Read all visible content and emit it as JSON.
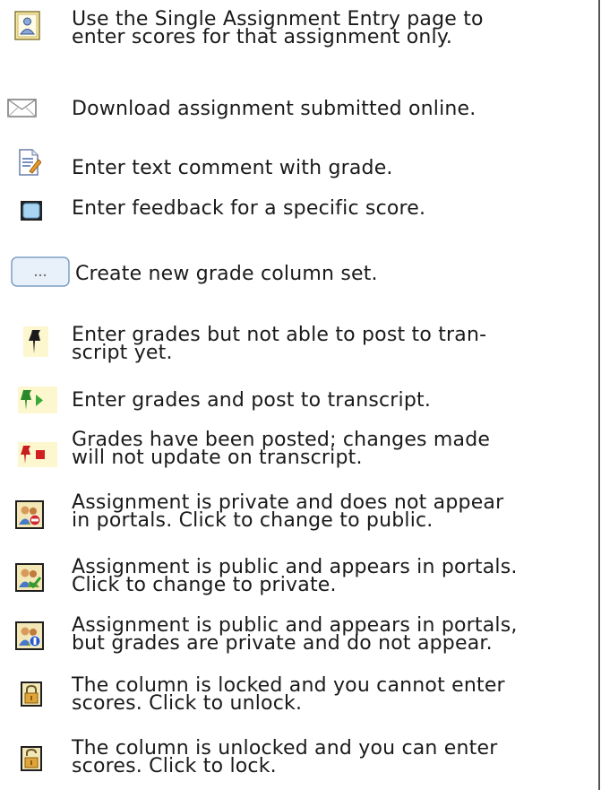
{
  "legend": [
    {
      "id": "single-entry",
      "icon": "single-entry-page-icon",
      "lines": [
        "Use the Single Assignment Entry page to",
        "enter scores for that assignment only."
      ]
    },
    {
      "id": "download",
      "icon": "envelope-icon",
      "lines": [
        "Download assignment submitted online."
      ]
    },
    {
      "id": "text-comment",
      "icon": "comment-document-icon",
      "lines": [
        "Enter text comment with grade."
      ]
    },
    {
      "id": "feedback",
      "icon": "feedback-box-icon",
      "lines": [
        "Enter feedback for a specific score."
      ]
    },
    {
      "id": "column-set",
      "icon": "ellipsis-button-icon",
      "lines": [
        "Create new grade column set."
      ]
    },
    {
      "id": "pin-not-post",
      "icon": "pushpin-icon",
      "lines": [
        "Enter grades but not able to post to tran-",
        "script yet."
      ]
    },
    {
      "id": "pin-post",
      "icon": "pushpin-arrow-icon",
      "lines": [
        "Enter grades and post to transcript."
      ]
    },
    {
      "id": "pin-posted",
      "icon": "pushpin-stop-icon",
      "lines": [
        "Grades have been posted; changes made",
        "will not update on transcript."
      ]
    },
    {
      "id": "private",
      "icon": "private-assignment-icon",
      "lines": [
        "Assignment is private and does not appear",
        "in portals. Click to change to public."
      ]
    },
    {
      "id": "public",
      "icon": "public-assignment-icon",
      "lines": [
        "Assignment is public and appears in portals.",
        "Click to change to private."
      ]
    },
    {
      "id": "public-private-grades",
      "icon": "public-private-grades-icon",
      "lines": [
        "Assignment is public and appears in portals,",
        "but grades are private and do not appear."
      ]
    },
    {
      "id": "locked",
      "icon": "lock-closed-icon",
      "lines": [
        "The column is locked and you cannot enter",
        "scores. Click to unlock."
      ]
    },
    {
      "id": "unlocked",
      "icon": "lock-open-icon",
      "lines": [
        "The column is unlocked and you can enter",
        "scores. Click to lock."
      ]
    }
  ]
}
